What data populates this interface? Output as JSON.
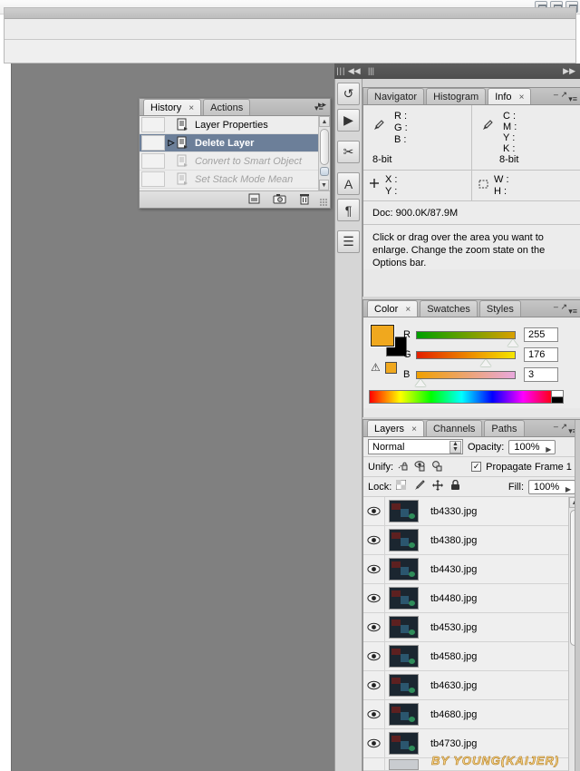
{
  "window": {
    "buttons": [
      "minimize",
      "maximize",
      "close"
    ]
  },
  "tool_dock": {
    "grip": "|||",
    "collapse": "◀◀",
    "buttons": [
      {
        "name": "history-actions-icon",
        "glyph": "↺"
      },
      {
        "name": "animation-icon",
        "glyph": "▶"
      },
      {
        "name": "tool-presets-icon",
        "glyph": "✂"
      },
      {
        "name": "character-icon",
        "glyph": "A"
      },
      {
        "name": "paragraph-icon",
        "glyph": "¶"
      },
      {
        "name": "layer-comps-icon",
        "glyph": "☰"
      }
    ]
  },
  "history_panel": {
    "expand_glyph": "▸▸",
    "menu_glyph": "▾≡",
    "tabs": [
      {
        "label": "History",
        "active": true,
        "closable": true
      },
      {
        "label": "Actions",
        "active": false,
        "closable": false
      }
    ],
    "close_glyph": "×",
    "states": [
      {
        "label": "Layer Properties",
        "selected": false,
        "dim": false,
        "marker": ""
      },
      {
        "label": "Delete Layer",
        "selected": true,
        "dim": false,
        "marker": "▷"
      },
      {
        "label": "Convert to Smart Object",
        "selected": false,
        "dim": true,
        "marker": ""
      },
      {
        "label": "Set Stack Mode Mean",
        "selected": false,
        "dim": true,
        "marker": ""
      }
    ],
    "scrollbar": {
      "up": "▲",
      "down": "▼"
    },
    "footer_buttons": [
      {
        "name": "new-document-from-state-button",
        "glyph": "▣"
      },
      {
        "name": "new-snapshot-button",
        "glyph": "□"
      },
      {
        "name": "delete-state-button",
        "glyph": "♲"
      }
    ]
  },
  "right_dock": {
    "grip": "|||",
    "collapse": "▶▶"
  },
  "info_panel": {
    "tabs": [
      {
        "label": "Navigator",
        "active": false,
        "closable": false
      },
      {
        "label": "Histogram",
        "active": false,
        "closable": false
      },
      {
        "label": "Info",
        "active": true,
        "closable": true
      }
    ],
    "close_glyph": "×",
    "minimize_glyph": "–",
    "maximize_glyph": "↗",
    "menu_glyph": "▾≡",
    "rgb": {
      "icon": "eyedropper-icon",
      "rows": [
        "R :",
        "G :",
        "B :"
      ],
      "bit_depth": "8-bit"
    },
    "cmyk": {
      "icon": "eyedropper-icon",
      "rows": [
        "C :",
        "M :",
        "Y :",
        "K :"
      ],
      "bit_depth": "8-bit"
    },
    "position": {
      "icon": "crosshair-icon",
      "rows": [
        "X :",
        "Y :"
      ]
    },
    "size": {
      "icon": "marquee-icon",
      "rows": [
        "W :",
        "H :"
      ]
    },
    "doc_info": "Doc: 900.0K/87.9M",
    "hint": "Click or drag over the area you want to enlarge. Change the zoom state on the Options bar."
  },
  "color_panel": {
    "tabs": [
      {
        "label": "Color",
        "active": true,
        "closable": true
      },
      {
        "label": "Swatches",
        "active": false,
        "closable": false
      },
      {
        "label": "Styles",
        "active": false,
        "closable": false
      }
    ],
    "close_glyph": "×",
    "menu_glyph": "▾≡",
    "minimize_glyph": "–",
    "maximize_glyph": "↗",
    "foreground_color": "#F0A81E",
    "background_color": "#000000",
    "out_of_gamut_glyph": "⚠",
    "web_safe_swatch": "#F0A81E",
    "channels": [
      {
        "label": "R",
        "value": "255",
        "pos": 0.97
      },
      {
        "label": "G",
        "value": "176",
        "pos": 0.69
      },
      {
        "label": "B",
        "value": "3",
        "pos": 0.02
      }
    ]
  },
  "layers_panel": {
    "tabs": [
      {
        "label": "Layers",
        "active": true,
        "closable": true
      },
      {
        "label": "Channels",
        "active": false,
        "closable": false
      },
      {
        "label": "Paths",
        "active": false,
        "closable": false
      }
    ],
    "close_glyph": "×",
    "menu_glyph": "▾≡",
    "minimize_glyph": "–",
    "maximize_glyph": "↗",
    "blend_mode": "Normal",
    "opacity_label": "Opacity:",
    "opacity_value": "100%",
    "unify_label": "Unify:",
    "unify_icons": [
      "unify-position-icon",
      "unify-visibility-icon",
      "unify-style-icon"
    ],
    "propagate_label": "Propagate Frame 1",
    "propagate_checked": true,
    "check_glyph": "✓",
    "lock_label": "Lock:",
    "lock_icons": [
      "lock-transparency-icon",
      "lock-image-icon",
      "lock-position-icon",
      "lock-all-icon"
    ],
    "fill_label": "Fill:",
    "fill_value": "100%",
    "eye_glyph": "◉",
    "layers": [
      {
        "name": "tb4330.jpg",
        "visible": true
      },
      {
        "name": "tb4380.jpg",
        "visible": true
      },
      {
        "name": "tb4430.jpg",
        "visible": true
      },
      {
        "name": "tb4480.jpg",
        "visible": true
      },
      {
        "name": "tb4530.jpg",
        "visible": true
      },
      {
        "name": "tb4580.jpg",
        "visible": true
      },
      {
        "name": "tb4630.jpg",
        "visible": true
      },
      {
        "name": "tb4680.jpg",
        "visible": true
      },
      {
        "name": "tb4730.jpg",
        "visible": true
      }
    ],
    "watermark": "BY YOUNG(KAIJER)"
  }
}
